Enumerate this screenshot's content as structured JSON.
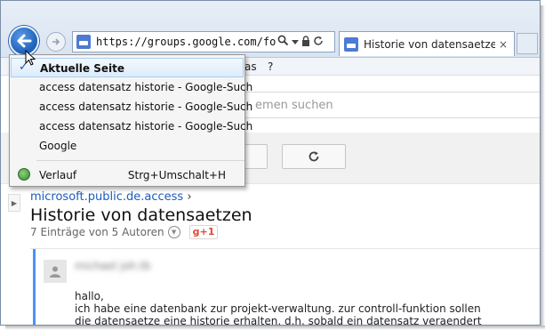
{
  "browser": {
    "address": "https://groups.google.com/forum/#!t",
    "tab_title": "Historie von datensaetzen –...",
    "tab_close": "×"
  },
  "menubar": {
    "item_partial": "as",
    "help": "?"
  },
  "history_menu": {
    "items": [
      {
        "label": "Aktuelle Seite"
      },
      {
        "label": "access datensatz historie - Google-Such"
      },
      {
        "label": "access datensatz historie - Google-Such"
      },
      {
        "label": "access datensatz historie - Google-Such"
      },
      {
        "label": "Google"
      }
    ],
    "history_label": "Verlauf",
    "history_shortcut": "Strg+Umschalt+H"
  },
  "page": {
    "search_placeholder": "emen suchen",
    "breadcrumb_group": "microsoft.public.de.access",
    "breadcrumb_sep": "›",
    "title": "Historie von datensaetzen",
    "meta": "7 Einträge von 5 Autoren",
    "gplus": "g+1",
    "post_author": "michael joh.tb",
    "post_lines": [
      "hallo,",
      "ich habe eine datenbank zur projekt-verwaltung. zur controll-funktion sollen",
      "die datensaetze eine historie erhalten, d.h. sobald ein datensatz veraendert"
    ]
  }
}
